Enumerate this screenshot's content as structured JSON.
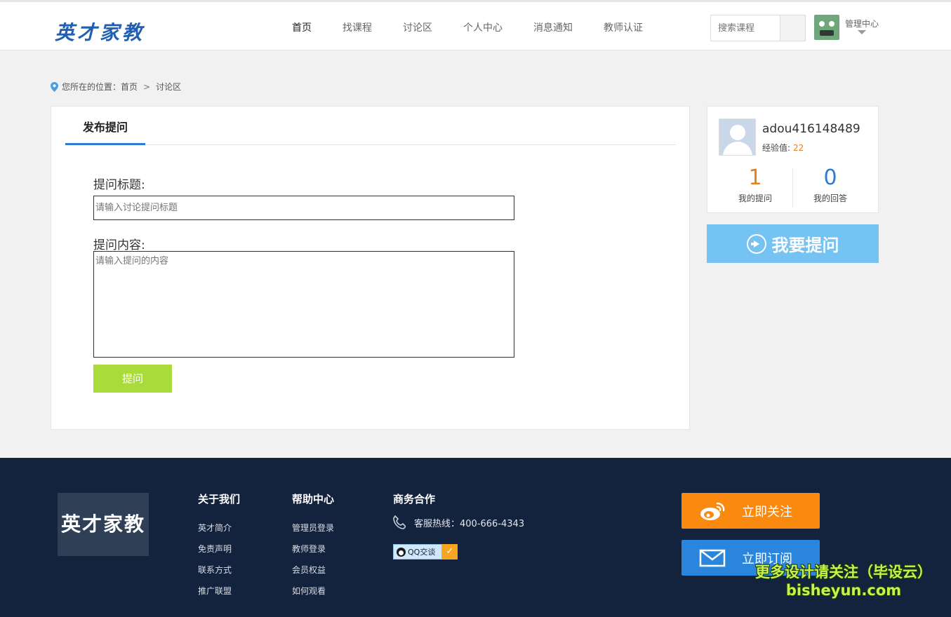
{
  "header": {
    "logo": "英才家教",
    "nav": [
      "首页",
      "找课程",
      "讨论区",
      "个人中心",
      "消息通知",
      "教师认证"
    ],
    "active_nav_index": 0,
    "search_placeholder": "搜索课程",
    "admin_label": "管理中心"
  },
  "breadcrumb": {
    "prefix": "您所在的位置：",
    "home": "首页",
    "separator": ">",
    "current": "讨论区"
  },
  "form": {
    "tab_label": "发布提问",
    "title_label": "提问标题:",
    "title_placeholder": "请输入讨论提问标题",
    "content_label": "提问内容:",
    "content_placeholder": "请输入提问的内容",
    "submit_label": "提问"
  },
  "user": {
    "name": "adou416148489",
    "exp_label": "经验值:",
    "exp_value": "22",
    "questions_count": "1",
    "questions_label": "我的提问",
    "answers_count": "0",
    "answers_label": "我的回答"
  },
  "ask_button": "我要提问",
  "footer": {
    "logo": "英才家教",
    "about": {
      "title": "关于我们",
      "links": [
        "英才简介",
        "免责声明",
        "联系方式",
        "推广联盟"
      ]
    },
    "help": {
      "title": "帮助中心",
      "links": [
        "管理员登录",
        "教师登录",
        "会员权益",
        "如何观看"
      ]
    },
    "business": {
      "title": "商务合作",
      "hotline": "客服热线：400-666-4343",
      "qq_label": "QQ交谈"
    },
    "follow_label": "立即关注",
    "subscribe_label": "立即订阅"
  },
  "watermark": {
    "line1": "更多设计请关注（毕设云）",
    "line2": "bisheyun.com"
  },
  "colors": {
    "accent_blue": "#2b7cd3",
    "submit_green": "#a9dc3a",
    "ask_button": "#75c3f3",
    "footer_bg": "#13223d",
    "follow_orange": "#f98a0f",
    "subscribe_blue": "#2a86dd",
    "stat_orange": "#e3821c",
    "stat_blue": "#2b7cd3"
  }
}
